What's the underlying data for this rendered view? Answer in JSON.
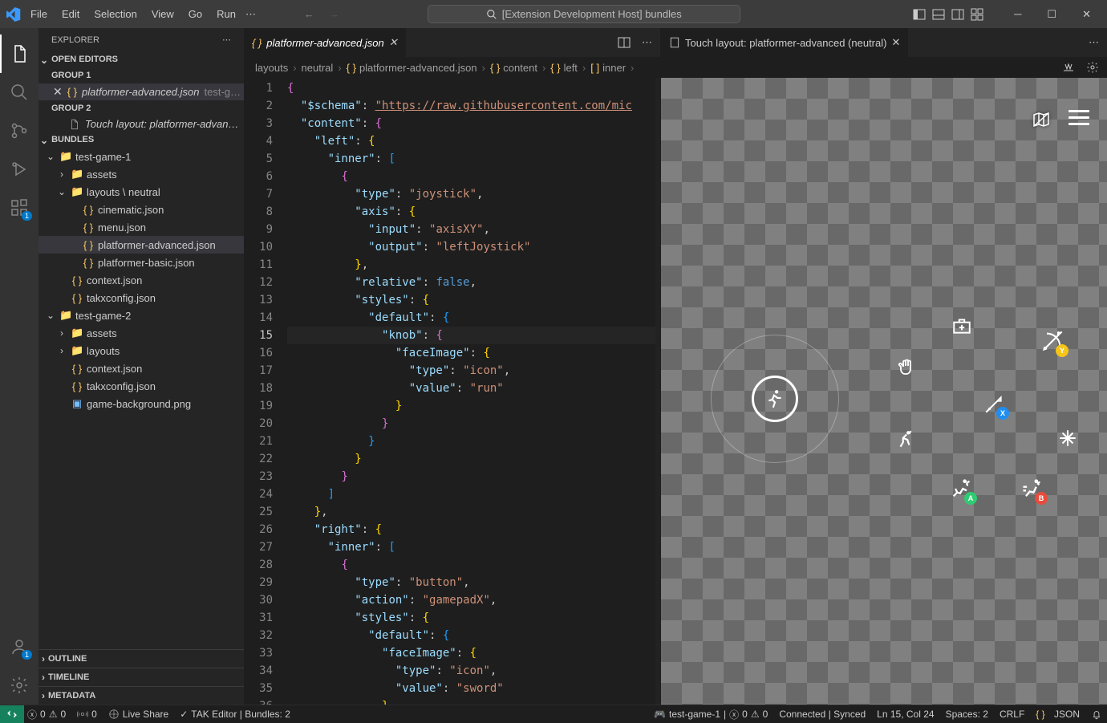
{
  "window": {
    "title": "[Extension Development Host] bundles"
  },
  "menu": {
    "items": [
      "File",
      "Edit",
      "Selection",
      "View",
      "Go",
      "Run"
    ]
  },
  "explorer": {
    "title": "EXPLORER",
    "openEditors": {
      "label": "OPEN EDITORS",
      "groups": [
        {
          "label": "GROUP 1",
          "items": [
            {
              "name": "platformer-advanced.json",
              "path": "test-g…",
              "active": true
            }
          ]
        },
        {
          "label": "GROUP 2",
          "items": [
            {
              "name": "Touch layout: platformer-advan…",
              "icon": "file",
              "active": false
            }
          ]
        }
      ]
    },
    "bundles": {
      "label": "BUNDLES",
      "tree": [
        {
          "depth": 0,
          "twist": "open",
          "icon": "folder-blue",
          "label": "test-game-1"
        },
        {
          "depth": 1,
          "twist": "closed",
          "icon": "folder",
          "label": "assets"
        },
        {
          "depth": 1,
          "twist": "open",
          "icon": "folder-blue",
          "label": "layouts \\ neutral"
        },
        {
          "depth": 2,
          "twist": "",
          "icon": "json",
          "label": "cinematic.json"
        },
        {
          "depth": 2,
          "twist": "",
          "icon": "json",
          "label": "menu.json"
        },
        {
          "depth": 2,
          "twist": "",
          "icon": "json",
          "label": "platformer-advanced.json",
          "selected": true
        },
        {
          "depth": 2,
          "twist": "",
          "icon": "json",
          "label": "platformer-basic.json"
        },
        {
          "depth": 1,
          "twist": "",
          "icon": "json",
          "label": "context.json"
        },
        {
          "depth": 1,
          "twist": "",
          "icon": "json",
          "label": "takxconfig.json"
        },
        {
          "depth": 0,
          "twist": "open",
          "icon": "folder-blue",
          "label": "test-game-2"
        },
        {
          "depth": 1,
          "twist": "closed",
          "icon": "folder",
          "label": "assets"
        },
        {
          "depth": 1,
          "twist": "closed",
          "icon": "folder-blue",
          "label": "layouts"
        },
        {
          "depth": 1,
          "twist": "",
          "icon": "json",
          "label": "context.json"
        },
        {
          "depth": 1,
          "twist": "",
          "icon": "json",
          "label": "takxconfig.json"
        },
        {
          "depth": 1,
          "twist": "",
          "icon": "img",
          "label": "game-background.png"
        }
      ]
    },
    "collapsed": {
      "outline": "OUTLINE",
      "timeline": "TIMELINE",
      "metadata": "METADATA"
    }
  },
  "leftEditor": {
    "tab": {
      "name": "platformer-advanced.json"
    },
    "breadcrumbs": [
      "layouts",
      "neutral",
      "platformer-advanced.json",
      "content",
      "left",
      "inner"
    ],
    "currentLine": 15,
    "code": [
      [
        [
          "brace",
          "{"
        ]
      ],
      [
        [
          "sp",
          "  "
        ],
        [
          "key",
          "\"$schema\""
        ],
        [
          "punc",
          ": "
        ],
        [
          "url",
          "\"https://raw.githubusercontent.com/mic"
        ]
      ],
      [
        [
          "sp",
          "  "
        ],
        [
          "key",
          "\"content\""
        ],
        [
          "punc",
          ": "
        ],
        [
          "brace",
          "{"
        ]
      ],
      [
        [
          "sp",
          "    "
        ],
        [
          "key",
          "\"left\""
        ],
        [
          "punc",
          ": "
        ],
        [
          "brace2",
          "{"
        ]
      ],
      [
        [
          "sp",
          "      "
        ],
        [
          "key",
          "\"inner\""
        ],
        [
          "punc",
          ": "
        ],
        [
          "brace3",
          "["
        ]
      ],
      [
        [
          "sp",
          "        "
        ],
        [
          "brace",
          "{"
        ]
      ],
      [
        [
          "sp",
          "          "
        ],
        [
          "key",
          "\"type\""
        ],
        [
          "punc",
          ": "
        ],
        [
          "str",
          "\"joystick\""
        ],
        [
          "punc",
          ","
        ]
      ],
      [
        [
          "sp",
          "          "
        ],
        [
          "key",
          "\"axis\""
        ],
        [
          "punc",
          ": "
        ],
        [
          "brace2",
          "{"
        ]
      ],
      [
        [
          "sp",
          "            "
        ],
        [
          "key",
          "\"input\""
        ],
        [
          "punc",
          ": "
        ],
        [
          "str",
          "\"axisXY\""
        ],
        [
          "punc",
          ","
        ]
      ],
      [
        [
          "sp",
          "            "
        ],
        [
          "key",
          "\"output\""
        ],
        [
          "punc",
          ": "
        ],
        [
          "str",
          "\"leftJoystick\""
        ]
      ],
      [
        [
          "sp",
          "          "
        ],
        [
          "brace2",
          "}"
        ],
        [
          "punc",
          ","
        ]
      ],
      [
        [
          "sp",
          "          "
        ],
        [
          "key",
          "\"relative\""
        ],
        [
          "punc",
          ": "
        ],
        [
          "bool",
          "false"
        ],
        [
          "punc",
          ","
        ]
      ],
      [
        [
          "sp",
          "          "
        ],
        [
          "key",
          "\"styles\""
        ],
        [
          "punc",
          ": "
        ],
        [
          "brace2",
          "{"
        ]
      ],
      [
        [
          "sp",
          "            "
        ],
        [
          "key",
          "\"default\""
        ],
        [
          "punc",
          ": "
        ],
        [
          "brace3",
          "{"
        ]
      ],
      [
        [
          "sp",
          "              "
        ],
        [
          "key",
          "\"knob\""
        ],
        [
          "punc",
          ": "
        ],
        [
          "brace",
          "{"
        ]
      ],
      [
        [
          "sp",
          "                "
        ],
        [
          "key",
          "\"faceImage\""
        ],
        [
          "punc",
          ": "
        ],
        [
          "brace2",
          "{"
        ]
      ],
      [
        [
          "sp",
          "                  "
        ],
        [
          "key",
          "\"type\""
        ],
        [
          "punc",
          ": "
        ],
        [
          "str",
          "\"icon\""
        ],
        [
          "punc",
          ","
        ]
      ],
      [
        [
          "sp",
          "                  "
        ],
        [
          "key",
          "\"value\""
        ],
        [
          "punc",
          ": "
        ],
        [
          "str",
          "\"run\""
        ]
      ],
      [
        [
          "sp",
          "                "
        ],
        [
          "brace2",
          "}"
        ]
      ],
      [
        [
          "sp",
          "              "
        ],
        [
          "brace",
          "}"
        ]
      ],
      [
        [
          "sp",
          "            "
        ],
        [
          "brace3",
          "}"
        ]
      ],
      [
        [
          "sp",
          "          "
        ],
        [
          "brace2",
          "}"
        ]
      ],
      [
        [
          "sp",
          "        "
        ],
        [
          "brace",
          "}"
        ]
      ],
      [
        [
          "sp",
          "      "
        ],
        [
          "brace3",
          "]"
        ]
      ],
      [
        [
          "sp",
          "    "
        ],
        [
          "brace2",
          "}"
        ],
        [
          "punc",
          ","
        ]
      ],
      [
        [
          "sp",
          "    "
        ],
        [
          "key",
          "\"right\""
        ],
        [
          "punc",
          ": "
        ],
        [
          "brace2",
          "{"
        ]
      ],
      [
        [
          "sp",
          "      "
        ],
        [
          "key",
          "\"inner\""
        ],
        [
          "punc",
          ": "
        ],
        [
          "brace3",
          "["
        ]
      ],
      [
        [
          "sp",
          "        "
        ],
        [
          "brace",
          "{"
        ]
      ],
      [
        [
          "sp",
          "          "
        ],
        [
          "key",
          "\"type\""
        ],
        [
          "punc",
          ": "
        ],
        [
          "str",
          "\"button\""
        ],
        [
          "punc",
          ","
        ]
      ],
      [
        [
          "sp",
          "          "
        ],
        [
          "key",
          "\"action\""
        ],
        [
          "punc",
          ": "
        ],
        [
          "str",
          "\"gamepadX\""
        ],
        [
          "punc",
          ","
        ]
      ],
      [
        [
          "sp",
          "          "
        ],
        [
          "key",
          "\"styles\""
        ],
        [
          "punc",
          ": "
        ],
        [
          "brace2",
          "{"
        ]
      ],
      [
        [
          "sp",
          "            "
        ],
        [
          "key",
          "\"default\""
        ],
        [
          "punc",
          ": "
        ],
        [
          "brace3",
          "{"
        ]
      ],
      [
        [
          "sp",
          "              "
        ],
        [
          "key",
          "\"faceImage\""
        ],
        [
          "punc",
          ": "
        ],
        [
          "brace2",
          "{"
        ]
      ],
      [
        [
          "sp",
          "                "
        ],
        [
          "key",
          "\"type\""
        ],
        [
          "punc",
          ": "
        ],
        [
          "str",
          "\"icon\""
        ],
        [
          "punc",
          ","
        ]
      ],
      [
        [
          "sp",
          "                "
        ],
        [
          "key",
          "\"value\""
        ],
        [
          "punc",
          ": "
        ],
        [
          "str",
          "\"sword\""
        ]
      ],
      [
        [
          "sp",
          "              "
        ],
        [
          "brace2",
          "}"
        ]
      ]
    ]
  },
  "rightEditor": {
    "tab": {
      "name": "Touch layout: platformer-advanced (neutral)"
    }
  },
  "statusBar": {
    "left": {
      "errors": "0",
      "warnings": "0",
      "ports": "0",
      "liveShare": "Live Share",
      "tak": "TAK Editor | Bundles: 2"
    },
    "right": {
      "game": "test-game-1",
      "errR": "0",
      "warnR": "0",
      "conn": "Connected | Synced",
      "pos": "Ln 15, Col 24",
      "spaces": "Spaces: 2",
      "eol": "CRLF",
      "lang": "JSON"
    }
  }
}
